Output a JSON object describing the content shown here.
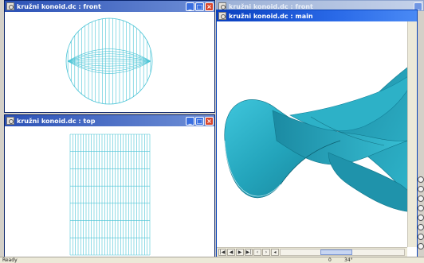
{
  "windows": {
    "front": {
      "title": "kružni konoid.dc : front"
    },
    "top": {
      "title": "kružni konoid.dc : top"
    },
    "main": {
      "title": "kružni konoid.dc : main"
    },
    "behind": {
      "title": "kružni konoid.dc : front"
    }
  },
  "buttons": {
    "minimize": "_",
    "maximize": "□",
    "close": "×"
  },
  "status": {
    "ready": "Ready",
    "field_a": "0",
    "field_b": "34°"
  },
  "colors": {
    "wire": "#4ac4d6",
    "surface": "#2aa0b6",
    "accent": "#0a3fbf"
  }
}
